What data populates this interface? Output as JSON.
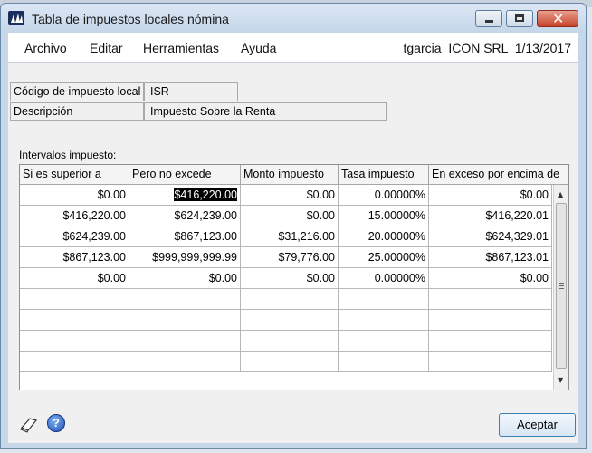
{
  "window": {
    "title": "Tabla de impuestos locales nómina",
    "close_glyph": "✕"
  },
  "menu": {
    "items": [
      "Archivo",
      "Editar",
      "Herramientas",
      "Ayuda"
    ],
    "user": "tgarcia",
    "company": "ICON SRL",
    "date": "1/13/2017"
  },
  "form": {
    "code_label": "Código de impuesto local",
    "code_value": "ISR",
    "description_label": "Descripción",
    "description_value": "Impuesto Sobre la Renta",
    "intervals_label": "Intervalos impuesto:"
  },
  "grid": {
    "columns": [
      "Si es superior a",
      "Pero no excede",
      "Monto impuesto",
      "Tasa impuesto",
      "En exceso por encima de"
    ],
    "rows": [
      [
        "$0.00",
        "$416,220.00",
        "$0.00",
        "0.00000%",
        "$0.00"
      ],
      [
        "$416,220.00",
        "$624,239.00",
        "$0.00",
        "15.00000%",
        "$416,220.01"
      ],
      [
        "$624,239.00",
        "$867,123.00",
        "$31,216.00",
        "20.00000%",
        "$624,329.01"
      ],
      [
        "$867,123.00",
        "$999,999,999.99",
        "$79,776.00",
        "25.00000%",
        "$867,123.01"
      ],
      [
        "$0.00",
        "$0.00",
        "$0.00",
        "0.00000%",
        "$0.00"
      ],
      [
        "",
        "",
        "",
        "",
        ""
      ],
      [
        "",
        "",
        "",
        "",
        ""
      ],
      [
        "",
        "",
        "",
        "",
        ""
      ],
      [
        "",
        "",
        "",
        "",
        ""
      ]
    ],
    "scroll_up": "▲",
    "scroll_down": "▼"
  },
  "footer": {
    "help_glyph": "?",
    "accept_label": "Aceptar"
  },
  "colors": {
    "window_frame": "#c6d7ea",
    "content_bg": "#f0f0f0",
    "close_button": "#c9432b",
    "help_icon": "#1d4fb8"
  }
}
